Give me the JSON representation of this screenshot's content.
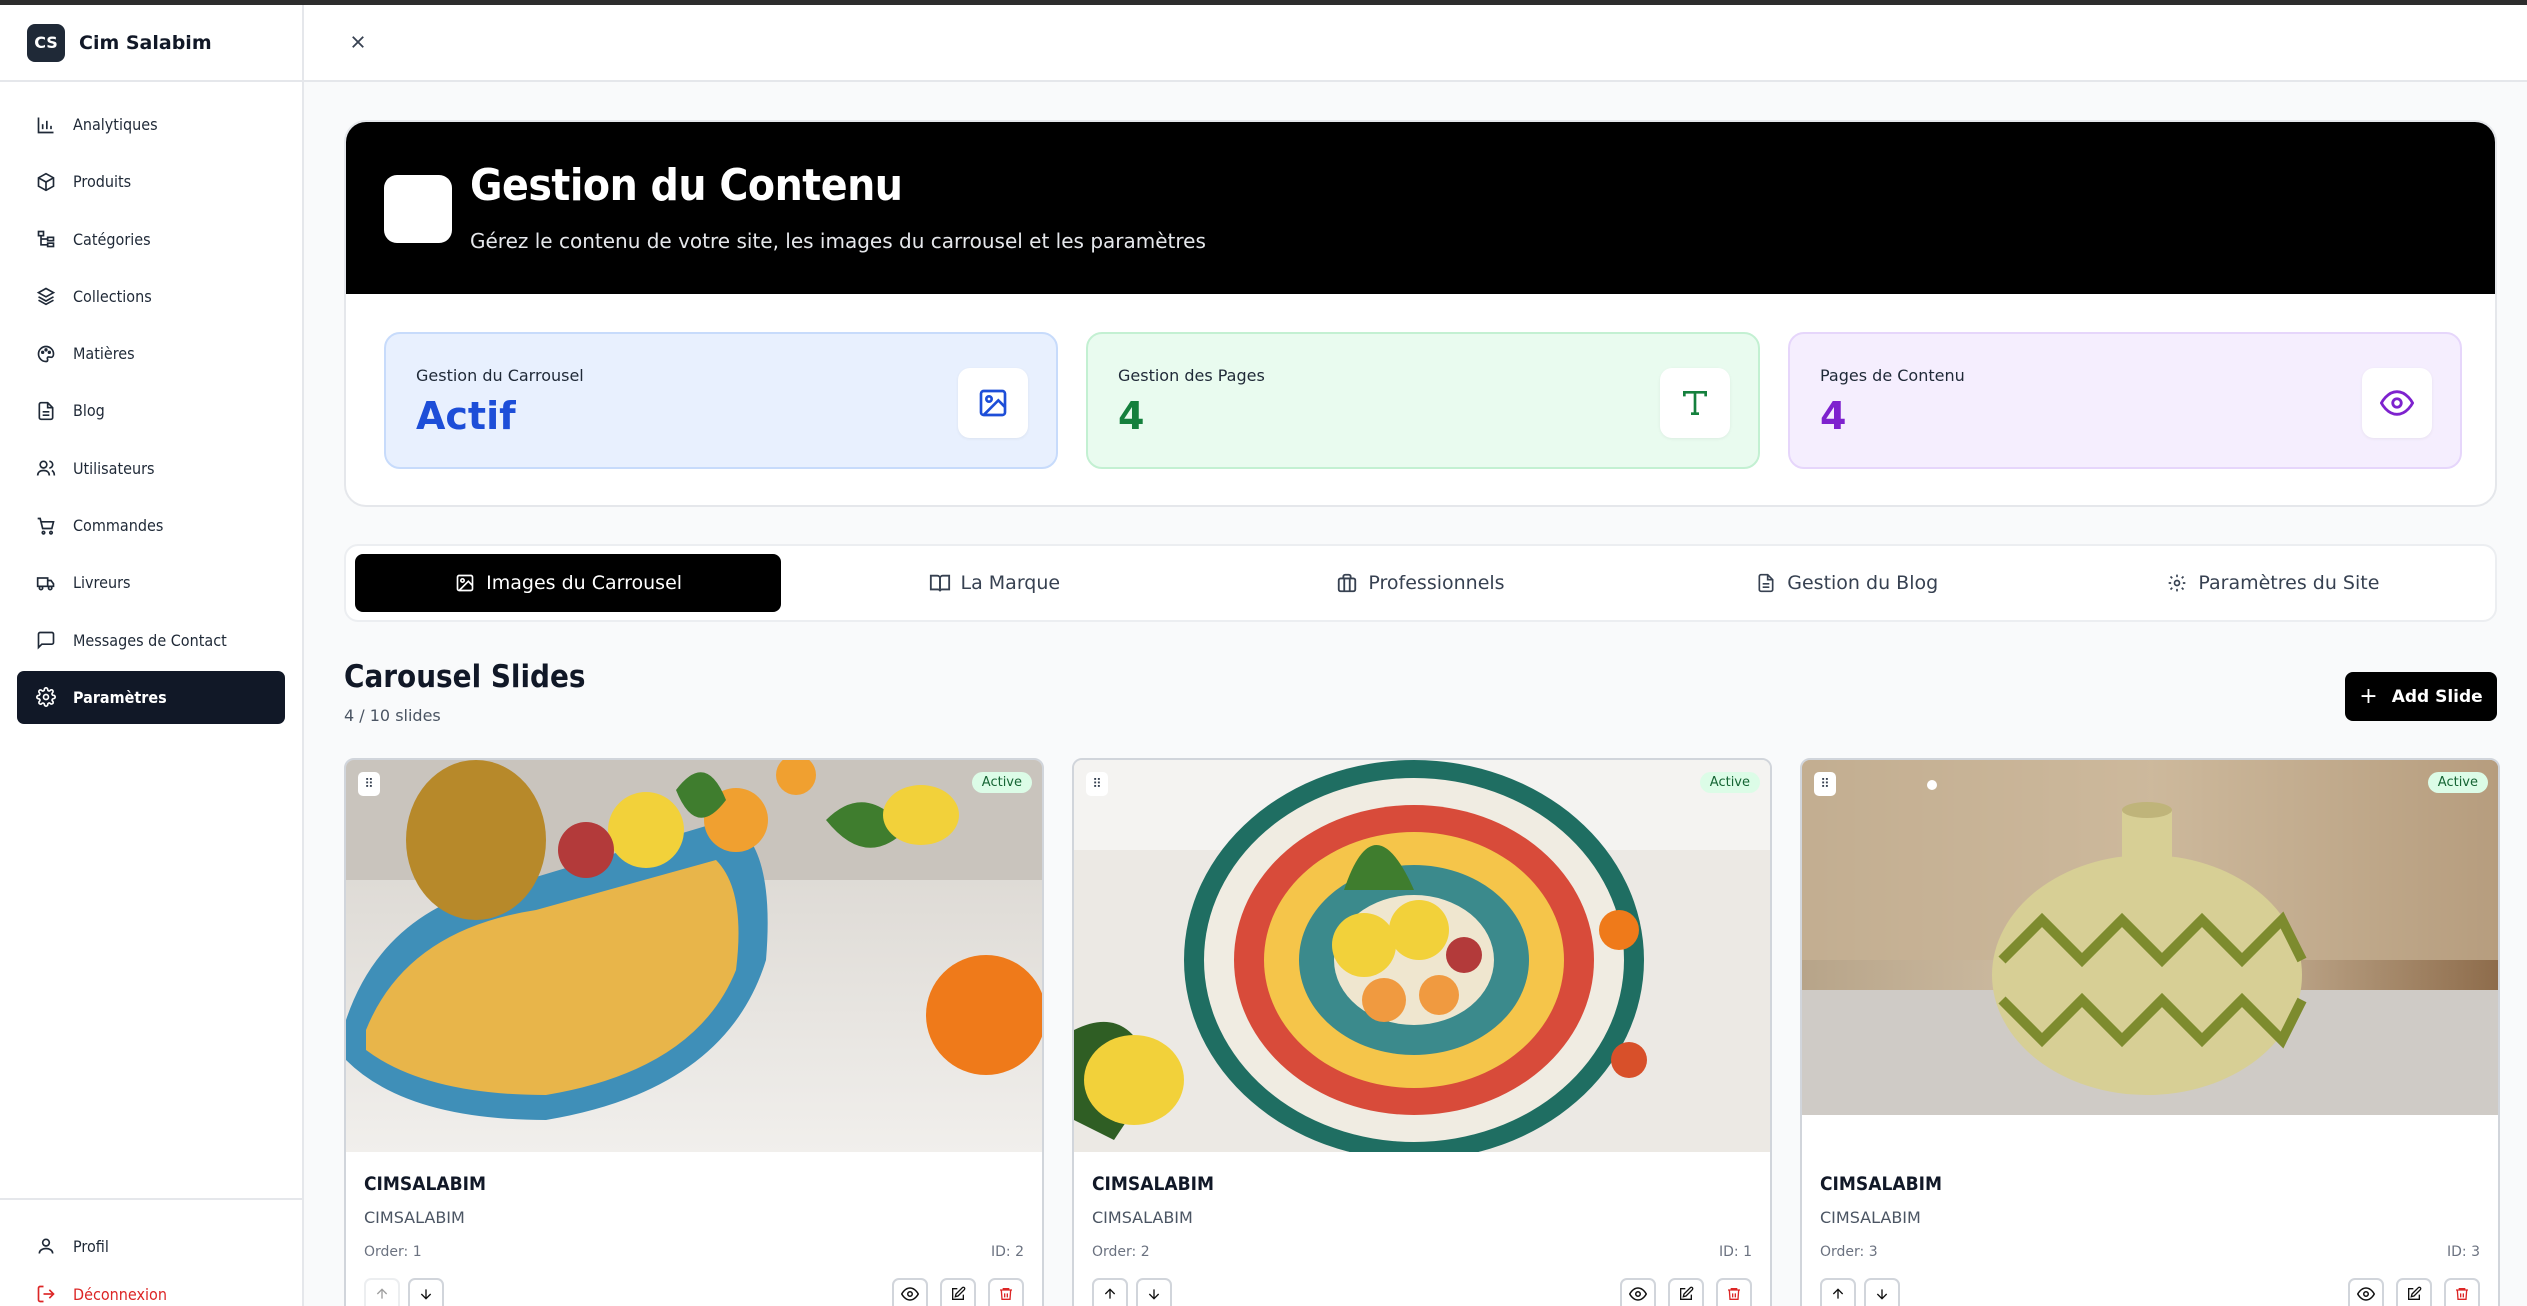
{
  "brand": {
    "initials": "CS",
    "name": "Cim Salabim"
  },
  "sidebar": {
    "items": [
      {
        "label": "Analytiques",
        "icon": "chart-icon"
      },
      {
        "label": "Produits",
        "icon": "package-icon"
      },
      {
        "label": "Catégories",
        "icon": "tree-icon"
      },
      {
        "label": "Collections",
        "icon": "layers-icon"
      },
      {
        "label": "Matières",
        "icon": "palette-icon"
      },
      {
        "label": "Blog",
        "icon": "document-icon"
      },
      {
        "label": "Utilisateurs",
        "icon": "users-icon"
      },
      {
        "label": "Commandes",
        "icon": "cart-icon"
      },
      {
        "label": "Livreurs",
        "icon": "truck-icon"
      },
      {
        "label": "Messages de Contact",
        "icon": "message-icon"
      },
      {
        "label": "Paramètres",
        "icon": "gear-icon",
        "active": true
      }
    ],
    "bottom": {
      "profile": "Profil",
      "logout": "Déconnexion"
    }
  },
  "hero": {
    "title": "Gestion du Contenu",
    "subtitle": "Gérez le contenu de votre site, les images du carrousel et les paramètres"
  },
  "stats": [
    {
      "label": "Gestion du Carrousel",
      "value": "Actif",
      "icon": "image-icon",
      "color": "#1d4ed8"
    },
    {
      "label": "Gestion des Pages",
      "value": "4",
      "icon": "text-icon",
      "color": "#15803d"
    },
    {
      "label": "Pages de Contenu",
      "value": "4",
      "icon": "eye-icon",
      "color": "#7e22ce"
    }
  ],
  "tabs": [
    {
      "label": "Images du Carrousel",
      "icon": "image-icon",
      "active": true
    },
    {
      "label": "La Marque",
      "icon": "book-icon"
    },
    {
      "label": "Professionnels",
      "icon": "briefcase-icon"
    },
    {
      "label": "Gestion du Blog",
      "icon": "document-icon"
    },
    {
      "label": "Paramètres du Site",
      "icon": "gear-icon"
    }
  ],
  "section": {
    "title": "Carousel Slides",
    "count": "4 / 10 slides",
    "add_label": "Add Slide"
  },
  "slides": [
    {
      "badge": "Active",
      "title": "CIMSALABIM",
      "subtitle": "CIMSALABIM",
      "order": "Order: 1",
      "id": "ID: 2"
    },
    {
      "badge": "Active",
      "title": "CIMSALABIM",
      "subtitle": "CIMSALABIM",
      "order": "Order: 2",
      "id": "ID: 1"
    },
    {
      "badge": "Active",
      "title": "CIMSALABIM",
      "subtitle": "CIMSALABIM",
      "order": "Order: 3",
      "id": "ID: 3"
    }
  ]
}
